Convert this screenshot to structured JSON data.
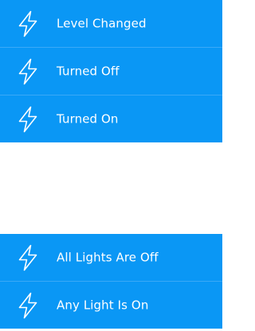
{
  "theme": {
    "item_background": "#0a97f5",
    "item_divider": "#3aa9f7",
    "text_color": "#ffffff",
    "page_background": "#ffffff"
  },
  "groups": [
    {
      "items": [
        {
          "icon": "lightning-bolt-icon",
          "label": "Level Changed"
        },
        {
          "icon": "lightning-bolt-icon",
          "label": "Turned Off"
        },
        {
          "icon": "lightning-bolt-icon",
          "label": "Turned On"
        }
      ]
    },
    {
      "items": [
        {
          "icon": "lightning-bolt-icon",
          "label": "All Lights Are Off"
        },
        {
          "icon": "lightning-bolt-icon",
          "label": "Any Light Is On"
        }
      ]
    }
  ]
}
